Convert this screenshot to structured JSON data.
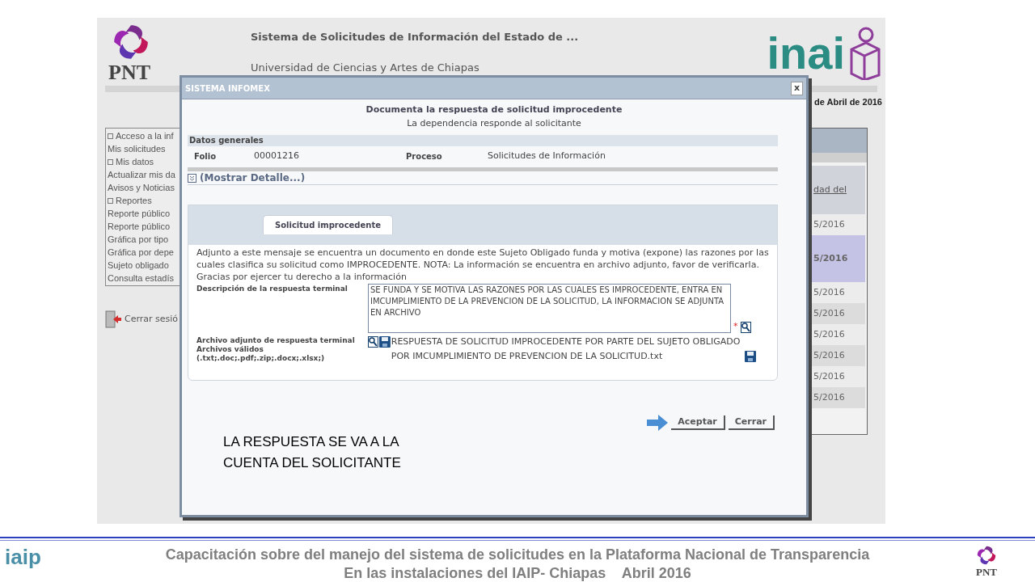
{
  "header": {
    "logo_text": "PNT",
    "title": "Sistema de Solicitudes de Información del Estado de ...",
    "institution": "Universidad de Ciencias y Artes de Chiapas",
    "brand": "inai",
    "date": "de Abril de 2016"
  },
  "sidebar": {
    "items": [
      {
        "label": "Acceso a la inf",
        "kind": "section"
      },
      {
        "label": "Mis solicitudes",
        "kind": "link"
      },
      {
        "label": "Mis datos",
        "kind": "section"
      },
      {
        "label": "Actualizar mis da",
        "kind": "link"
      },
      {
        "label": "Avisos y Noticias",
        "kind": "link"
      },
      {
        "label": "Reportes",
        "kind": "section"
      },
      {
        "label": "Reporte público",
        "kind": "link"
      },
      {
        "label": "Reporte público",
        "kind": "link"
      },
      {
        "label": "Gráfica por tipo",
        "kind": "link"
      },
      {
        "label": "Gráfica por depe",
        "kind": "link"
      },
      {
        "label": "Sujeto obligado",
        "kind": "link"
      },
      {
        "label": "Consulta estadís",
        "kind": "link"
      }
    ],
    "logout": "Cerrar sesió"
  },
  "table": {
    "column_header": "dad del",
    "rows": [
      {
        "date": "5/2016",
        "selected": false
      },
      {
        "date": "5/2016",
        "selected": true
      },
      {
        "date": "5/2016",
        "selected": false
      },
      {
        "date": "5/2016",
        "selected": false
      },
      {
        "date": "5/2016",
        "selected": false
      },
      {
        "date": "5/2016",
        "selected": false
      },
      {
        "date": "5/2016",
        "selected": false
      },
      {
        "date": "5/2016",
        "selected": false
      }
    ]
  },
  "dialog": {
    "title": "SISTEMA INFOMEX",
    "close": "x",
    "heading": "Documenta la respuesta de solicitud improcedente",
    "subheading": "La dependencia responde al solicitante",
    "section": "Datos generales",
    "fields": [
      {
        "label": "Folio",
        "value": "00001216"
      },
      {
        "label": "Proceso",
        "value": "Solicitudes de Información"
      }
    ],
    "details_toggle": "(Mostrar Detalle...)",
    "tabs": [
      {
        "label": "Solicitud improcedente",
        "selected": true
      }
    ],
    "message": "Adjunto a este mensaje se encuentra un documento en donde este Sujeto Obligado funda y motiva (expone) las razones por las cuales clasifica su solicitud como IMPROCEDENTE. NOTA: La información se encuentra en archivo adjunto, favor de verificarla. Gracias por ejercer tu derecho a la información",
    "description_label": "Descripción de la respuesta terminal",
    "description_value": "SE FUNDA Y SE MOTIVA LAS RAZONES POR LAS CUALES ES IMPROCEDENTE, ENTRA EN IMCUMPLIMIENTO DE LA PREVENCION DE LA SOLICITUD, LA INFORMACION SE ADJUNTA EN ARCHIVO",
    "required_mark": "*",
    "attachment_labels": [
      "Archivo adjunto de respuesta terminal",
      "Archivos válidos",
      "(.txt;.doc;.pdf;.zip;.docx;.xlsx;)"
    ],
    "attachment_file": "RESPUESTA DE SOLICITUD IMPROCEDENTE POR PARTE DEL SUJETO OBLIGADO POR IMCUMPLIMIENTO DE PREVENCION DE LA SOLICITUD.txt",
    "buttons": [
      "Aceptar",
      "Cerrar"
    ]
  },
  "annotation": [
    "LA RESPUESTA SE VA A LA",
    "CUENTA DEL SOLICITANTE"
  ],
  "footer": {
    "lines": [
      "Capacitación sobre del manejo del sistema de solicitudes en la Plataforma Nacional de Transparencia",
      "En las instalaciones del IAIP- Chiapas    Abril 2016"
    ],
    "left_logo_text": "iaip",
    "right_logo_text": "PNT"
  }
}
